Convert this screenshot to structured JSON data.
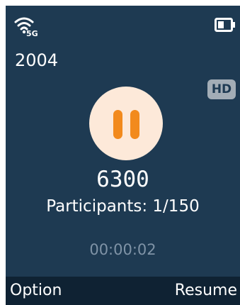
{
  "status_bar": {
    "signal_label": "5G",
    "wifi_icon": "wifi-icon",
    "battery_icon": "battery-icon",
    "battery_level": 0.5
  },
  "call": {
    "account": "2004",
    "hd_label": "HD",
    "state_icon": "pause-icon",
    "number": "6300",
    "participants": "Participants: 1/150",
    "timer": "00:00:02"
  },
  "softkeys": {
    "left": "Option",
    "right": "Resume"
  },
  "colors": {
    "background": "#1e3a52",
    "softkey_bar": "#0f2233",
    "pause_circle": "#fde9d9",
    "pause_bars": "#f28a1d",
    "timer_text": "#7f93a6",
    "hd_badge": "#a3adb6"
  }
}
